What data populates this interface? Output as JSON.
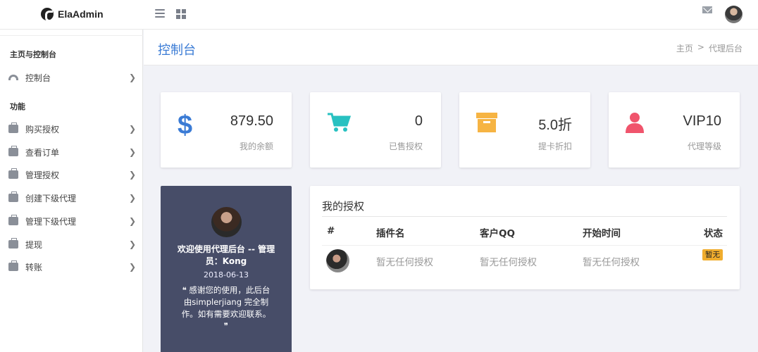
{
  "topbar": {
    "logo_text": "ElaAdmin",
    "icons": [
      "menu-icon",
      "grid-icon",
      "mail-icon",
      "user-avatar"
    ]
  },
  "sidebar": {
    "section1_title": "主页与控制台",
    "section2_title": "功能",
    "items": [
      {
        "label": "控制台",
        "icon": "dashboard-icon"
      },
      {
        "label": "购买授权",
        "icon": "briefcase-icon"
      },
      {
        "label": "查看订单",
        "icon": "briefcase-icon"
      },
      {
        "label": "管理授权",
        "icon": "briefcase-icon"
      },
      {
        "label": "创建下级代理",
        "icon": "briefcase-icon"
      },
      {
        "label": "管理下级代理",
        "icon": "briefcase-icon"
      },
      {
        "label": "提现",
        "icon": "briefcase-icon"
      },
      {
        "label": "转账",
        "icon": "briefcase-icon"
      }
    ]
  },
  "header": {
    "title": "控制台",
    "breadcrumb": [
      "主页",
      ">",
      "代理后台"
    ]
  },
  "stats": [
    {
      "value": "879.50",
      "label": "我的余额",
      "icon": "dollar-icon",
      "color": "#3a7bd5"
    },
    {
      "value": "0",
      "label": "已售授权",
      "icon": "cart-icon",
      "color": "#28c1c1"
    },
    {
      "value": "5.0折",
      "label": "提卡折扣",
      "icon": "archive-box-icon",
      "color": "#f6b443"
    },
    {
      "value": "VIP10",
      "label": "代理等级",
      "icon": "user-icon",
      "color": "#f0546c"
    }
  ],
  "profile": {
    "name": "欢迎使用代理后台 -- 管理员：Kong",
    "date": "2018-06-13",
    "quote_open": "❝",
    "quote": "感谢您的使用，此后台由simplerjiang 完全制作。如有需要欢迎联系。",
    "quote_close": "❞",
    "background": "#474d68"
  },
  "auth_table": {
    "title": "我的授权",
    "headers": [
      "#",
      "插件名",
      "客户QQ",
      "开始时间",
      "状态"
    ],
    "rows": [
      {
        "plugin": "暂无任何授权",
        "qq": "暂无任何授权",
        "start": "暂无任何授权",
        "status": "暂无"
      }
    ]
  }
}
